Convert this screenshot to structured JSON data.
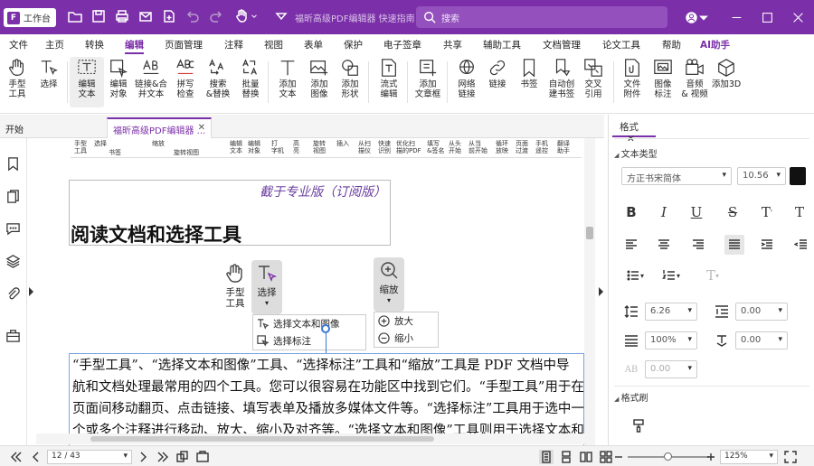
{
  "app": {
    "workspace_label": "工作台",
    "doc_title": "福昕高级PDF编辑器 快速指南 *",
    "search_placeholder": "搜索"
  },
  "menus": [
    "文件",
    "主页",
    "转换",
    "编辑",
    "页面管理",
    "注释",
    "视图",
    "表单",
    "保护",
    "电子签章",
    "共享",
    "辅助工具",
    "文档管理",
    "论文工具",
    "帮助",
    "AI助手"
  ],
  "active_menu": "编辑",
  "tools": [
    {
      "label": "手型\n工具",
      "icon": "hand-icon"
    },
    {
      "label": "选择\n ",
      "icon": "select-text-icon"
    },
    {
      "label": "编辑\n文本",
      "icon": "edit-text-icon"
    },
    {
      "label": "编辑\n对象",
      "icon": "edit-object-icon"
    },
    {
      "label": "链接&合\n并文本",
      "icon": "link-merge-text-icon"
    },
    {
      "label": "拼写\n检查",
      "icon": "spell-check-icon"
    },
    {
      "label": "搜索\n&替换",
      "icon": "search-replace-icon"
    },
    {
      "label": "批量\n替换",
      "icon": "batch-replace-icon"
    },
    {
      "label": "添加\n文本",
      "icon": "add-text-icon"
    },
    {
      "label": "添加\n图像",
      "icon": "add-image-icon"
    },
    {
      "label": "添加\n形状",
      "icon": "add-shape-icon"
    },
    {
      "label": "流式\n编辑",
      "icon": "flow-edit-icon"
    },
    {
      "label": "添加\n文章框",
      "icon": "add-article-box-icon"
    },
    {
      "label": "网络\n链接",
      "icon": "web-link-icon"
    },
    {
      "label": "链接\n ",
      "icon": "link-icon"
    },
    {
      "label": "书签\n ",
      "icon": "bookmark-icon"
    },
    {
      "label": "自动创\n建书签",
      "icon": "auto-bookmark-icon"
    },
    {
      "label": "交叉\n引用",
      "icon": "cross-reference-icon"
    },
    {
      "label": "文件\n附件",
      "icon": "file-attachment-icon"
    },
    {
      "label": "图像\n标注",
      "icon": "image-annotation-icon"
    },
    {
      "label": "音频\n& 视频",
      "icon": "audio-video-icon"
    },
    {
      "label": "添加3D\n ",
      "icon": "add-3d-icon"
    }
  ],
  "tabs": {
    "start": "开始",
    "doc": "福昕高级PDF编辑器 ..."
  },
  "page": {
    "mini_toolbar": [
      "手型\n工具",
      "选择\n ",
      "缩放\n ",
      "编辑\n文本",
      "编辑\n对象",
      "打\n字机",
      "高\n亮",
      "旋转\n视图",
      "插入\n ",
      "从扫\n描仪",
      "快速\n识别",
      "优化扫\n描的PDF",
      "填写\n&签名",
      "从头\n开始",
      "从当\n前开始",
      "循环\n放映",
      "页面\n过渡",
      "手机\n遥控",
      "翻译\n助手"
    ],
    "mini_sub": [
      "书签",
      "旋转视图"
    ],
    "edition": "截于专业版（订阅版）",
    "heading": "阅读文档和选择工具",
    "illus": {
      "hand": "手型\n工具",
      "select": "选择",
      "zoom": "缩放",
      "select_items": [
        "选择文本和图像",
        "选择标注"
      ],
      "zoom_items": [
        "放大",
        "缩小"
      ]
    },
    "body_lines": [
      "“手型工具”、“选择文本和图像”工具、“选择标注”工具和“缩放”工具是 PDF 文档中导",
      "航和文档处理最常用的四个工具。您可以很容易在功能区中找到它们。“手型工具”用于在",
      "页面间移动翻页、点击链接、填写表单及播放多媒体文件等。“选择标注”工具用于选中一",
      "个或多个注释进行移动、放大、缩小及对齐等。“选择文本和图像”工具则用于选择文本和"
    ]
  },
  "format_panel": {
    "tab": "格式",
    "text_type": "文本类型",
    "font": "方正书宋简体",
    "size": "10.56",
    "color": "#111111",
    "line_spacing": "6.26",
    "para_spacing": "0.00",
    "scale": "100%",
    "baseline": "0.00",
    "char_spacing": "0.00",
    "brush_label": "格式刷"
  },
  "status": {
    "page": "12 / 43",
    "zoom": "125%"
  }
}
